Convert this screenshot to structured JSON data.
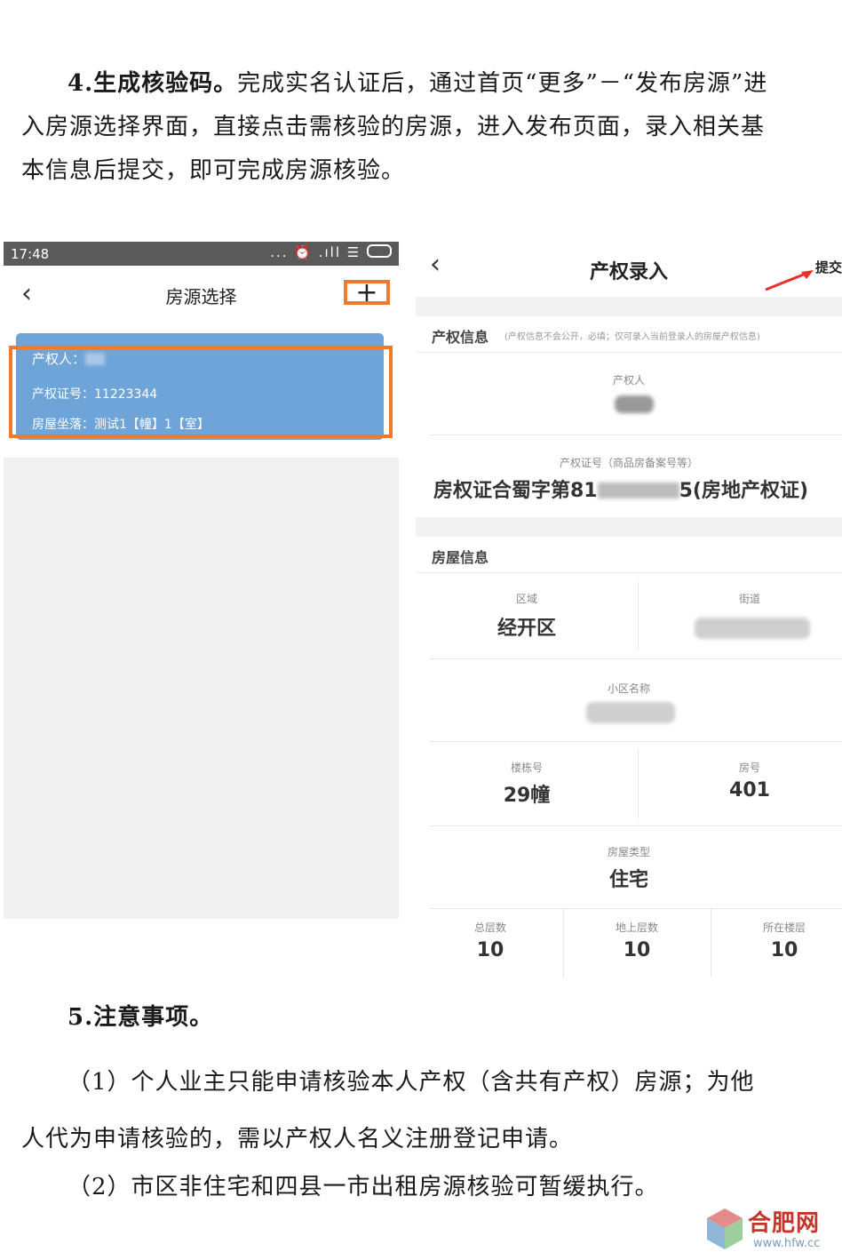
{
  "section4": {
    "heading": "4.生成核验码。",
    "body": "完成实名认证后，通过首页“更多”－“发布房源”进入房源选择界面，直接点击需核验的房源，进入发布页面，录入相关基本信息后提交，即可完成房源核验。"
  },
  "left_phone": {
    "status_time": "17:48",
    "status_icons": "... ⏰ .ıll ☰",
    "back_icon": "‹",
    "title": "房源选择",
    "add_icon": "+",
    "card": {
      "owner_label": "产权人：",
      "cert_label": "产权证号：",
      "cert_value": "11223344",
      "location_label": "房屋坐落：",
      "location_value": "测试1【幢】1【室】"
    }
  },
  "right_phone": {
    "back_icon": "‹",
    "title": "产权录入",
    "submit": "提交",
    "section_property": "产权信息",
    "section_property_note": "(产权信息不会公开，必填；仅可录入当前登录人的房屋产权信息)",
    "owner_label": "产权人",
    "cert_label": "产权证号（商品房备案号等）",
    "cert_prefix": "房权证合蜀字第81",
    "cert_suffix": "5(房地产权证)",
    "section_house": "房屋信息",
    "district_label": "区域",
    "district_value": "经开区",
    "street_label": "街道",
    "community_label": "小区名称",
    "building_label": "楼栋号",
    "building_value": "29幢",
    "room_label": "房号",
    "room_value": "401",
    "house_type_label": "房屋类型",
    "house_type_value": "住宅",
    "total_floors_label": "总层数",
    "total_floors_value": "10",
    "above_floors_label": "地上层数",
    "above_floors_value": "10",
    "floor_label": "所在楼层",
    "floor_value": "10"
  },
  "section5": {
    "heading": "5.注意事项。",
    "item1": "（1）个人业主只能申请核验本人产权（含共有产权）房源；为他人代为申请核验的，需以产权人名义注册登记申请。",
    "item2": "（2）市区非住宅和四县一市出租房源核验可暂缓执行。"
  },
  "watermark": {
    "logo_text": "合肥网",
    "site": "www.hfw.cc"
  },
  "colors": {
    "highlight": "#f07a2a",
    "card_bg": "#6fa4d8",
    "arrow": "#e8302a",
    "watermark_red": "#c8332c"
  }
}
